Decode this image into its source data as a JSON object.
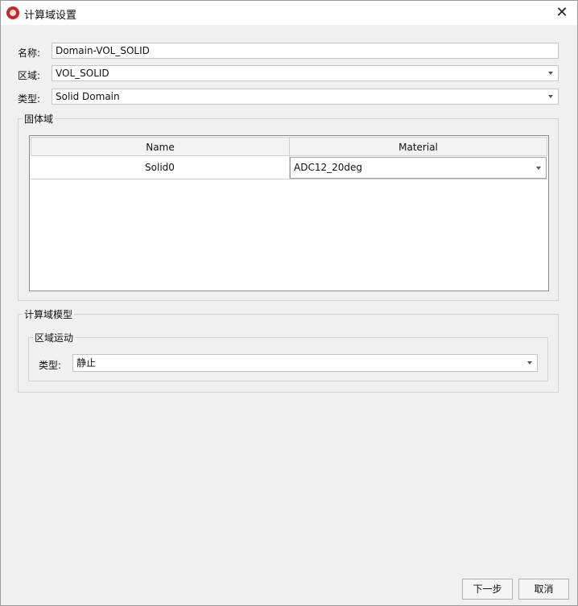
{
  "window": {
    "title": "计算域设置"
  },
  "form": {
    "name_label": "名称:",
    "name_value": "Domain-VOL_SOLID",
    "region_label": "区域:",
    "region_value": "VOL_SOLID",
    "type_label": "类型:",
    "type_value": "Solid Domain"
  },
  "solid_group": {
    "title": "固体域",
    "columns": [
      "Name",
      "Material"
    ],
    "rows": [
      {
        "name": "Solid0",
        "material": "ADC12_20deg"
      }
    ]
  },
  "model_group": {
    "title": "计算域模型",
    "motion": {
      "title": "区域运动",
      "type_label": "类型:",
      "type_value": "静止"
    }
  },
  "footer": {
    "next_label": "下一步",
    "cancel_label": "取消"
  },
  "colors": {
    "app_icon": "#c62828",
    "background": "#f0f0f0"
  }
}
